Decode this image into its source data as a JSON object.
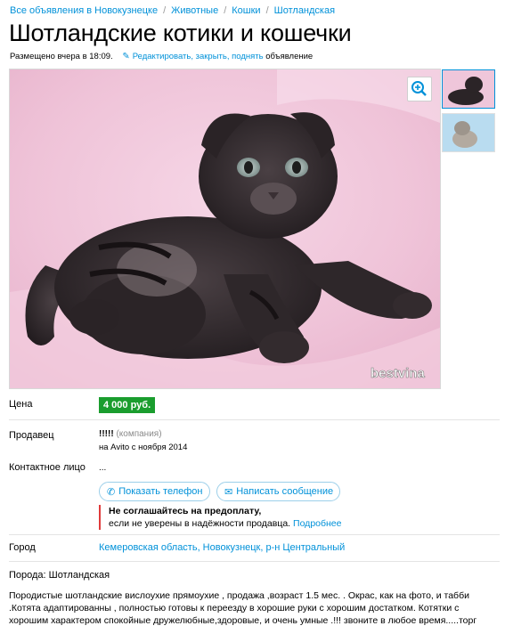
{
  "breadcrumb": [
    "Все объявления в Новокузнецке",
    "Животные",
    "Кошки",
    "Шотландская"
  ],
  "title": "Шотландские котики и кошечки",
  "meta": {
    "posted": "Размещено вчера в 18:09.",
    "edit_link": "Редактировать, закрыть, поднять",
    "edit_suffix": "объявление"
  },
  "photo": {
    "watermark": "bestvina"
  },
  "price": {
    "label": "Цена",
    "value": "4 000 руб."
  },
  "seller": {
    "label": "Продавец",
    "name": "!!!!!",
    "type": "(компания)",
    "since": "на Avito с ноября 2014"
  },
  "contact": {
    "label": "Контактное лицо",
    "value": "...",
    "show_phone": "Показать телефон",
    "write_message": "Написать сообщение"
  },
  "warning": {
    "heading": "Не соглашайтесь на предоплату,",
    "text": "если не уверены в надёжности продавца.",
    "more": "Подробнее"
  },
  "city": {
    "label": "Город",
    "value": "Кемеровская область, Новокузнецк, р-н Центральный"
  },
  "breed_line": "Порода: Шотландская",
  "description": [
    "Породистые шотландские вислоухие прямоухие , продажа ,возраст 1.5 мес. . Окрас, как на фото, и табби",
    ".Котята адаптированны , полностью готовы к переезду в хорошие руки с хорошим достатком. Котятки с",
    "хорошим характером спокойные дружелюбные,здоровые, и очень умные .!!! звоните в любое время.....торг"
  ],
  "colors": {
    "link": "#0091d9",
    "price_bg": "#1a9d2e",
    "warning_border": "#e03b3b"
  }
}
